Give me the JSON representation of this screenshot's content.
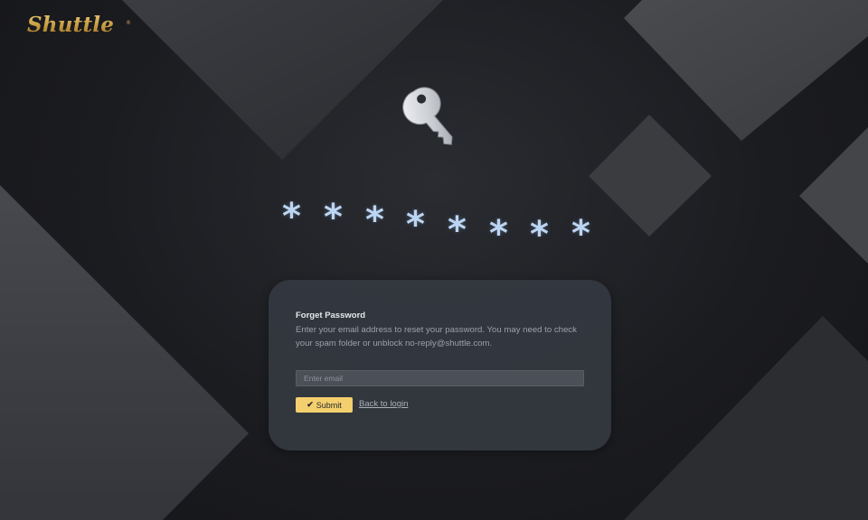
{
  "brand": {
    "logo_text": "Shuttle",
    "registered_mark": "®",
    "accent_color": "#c69a3e"
  },
  "hero": {
    "key_icon": "key-icon",
    "masked_password": [
      "*",
      "*",
      "*",
      "*",
      "*",
      "*",
      "*",
      "*"
    ],
    "mask_color": "#bcd5f2"
  },
  "forgot_password": {
    "title": "Forget Password",
    "description": "Enter your email address to reset your password. You may need to check your spam folder or unblock no-reply@shuttle.com.",
    "email_placeholder": "Enter email",
    "email_value": "",
    "submit_icon": "check-icon",
    "submit_label": "Submit",
    "submit_color": "#f3cf6e",
    "back_link_label": "Back to login"
  }
}
